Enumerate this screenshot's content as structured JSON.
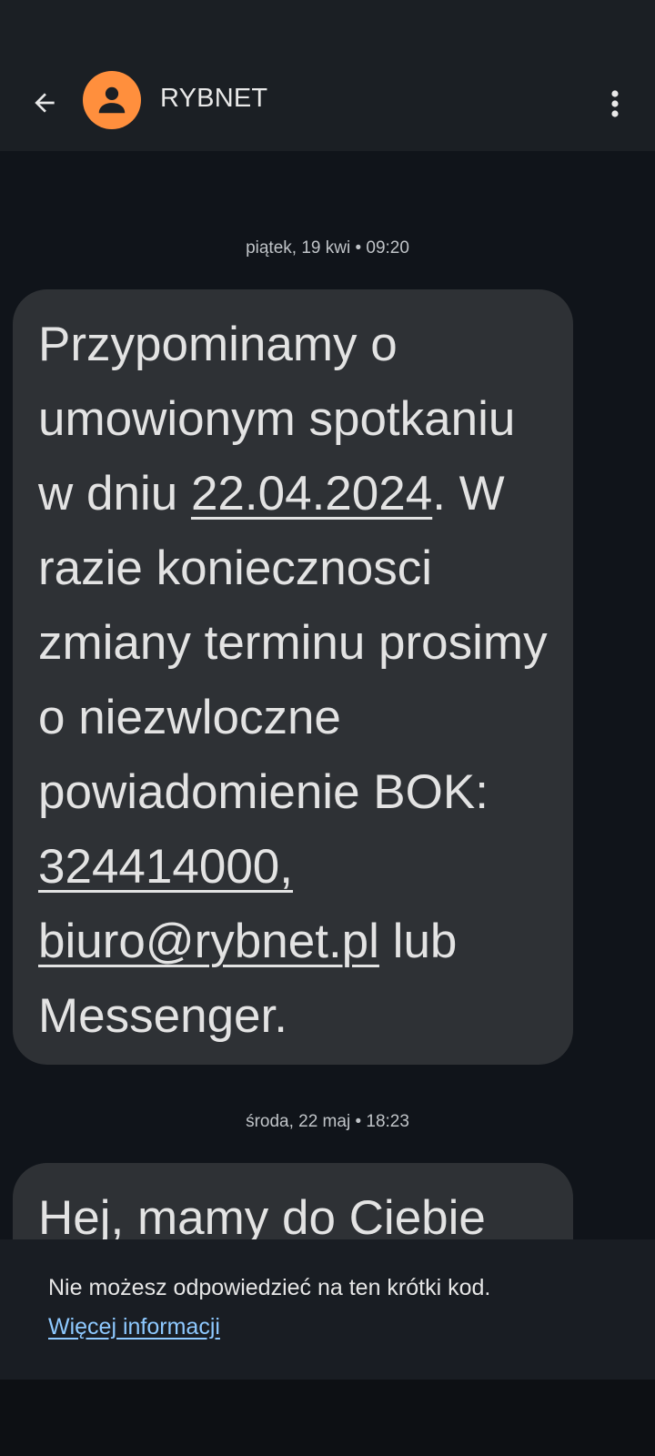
{
  "header": {
    "title": "RYBNET",
    "back_icon": "arrow-back-icon",
    "avatar_icon": "person-icon",
    "menu_icon": "more-vert-icon",
    "avatar_color": "#ff8f3d"
  },
  "messages": [
    {
      "date": "piątek, 19 kwi • 09:20",
      "parts": {
        "t1": "Przypominamy o umowionym spotkaniu w dniu ",
        "link_date": "22.04.2024",
        "t2": ". W razie koniecznosci zmiany terminu prosimy o niezwloczne powiadomienie BOK: ",
        "link_phone": "324414000,",
        "t3": " ",
        "link_email": "biuro@rybnet.pl",
        "t4": " lub Messenger."
      }
    },
    {
      "date": "środa, 22 maj • 18:23",
      "text": "Hej, mamy do Ciebie"
    }
  ],
  "footer": {
    "notice": "Nie możesz odpowiedzieć na ten krótki kod.",
    "link": "Więcej informacji",
    "link_color": "#8ec9ff"
  }
}
